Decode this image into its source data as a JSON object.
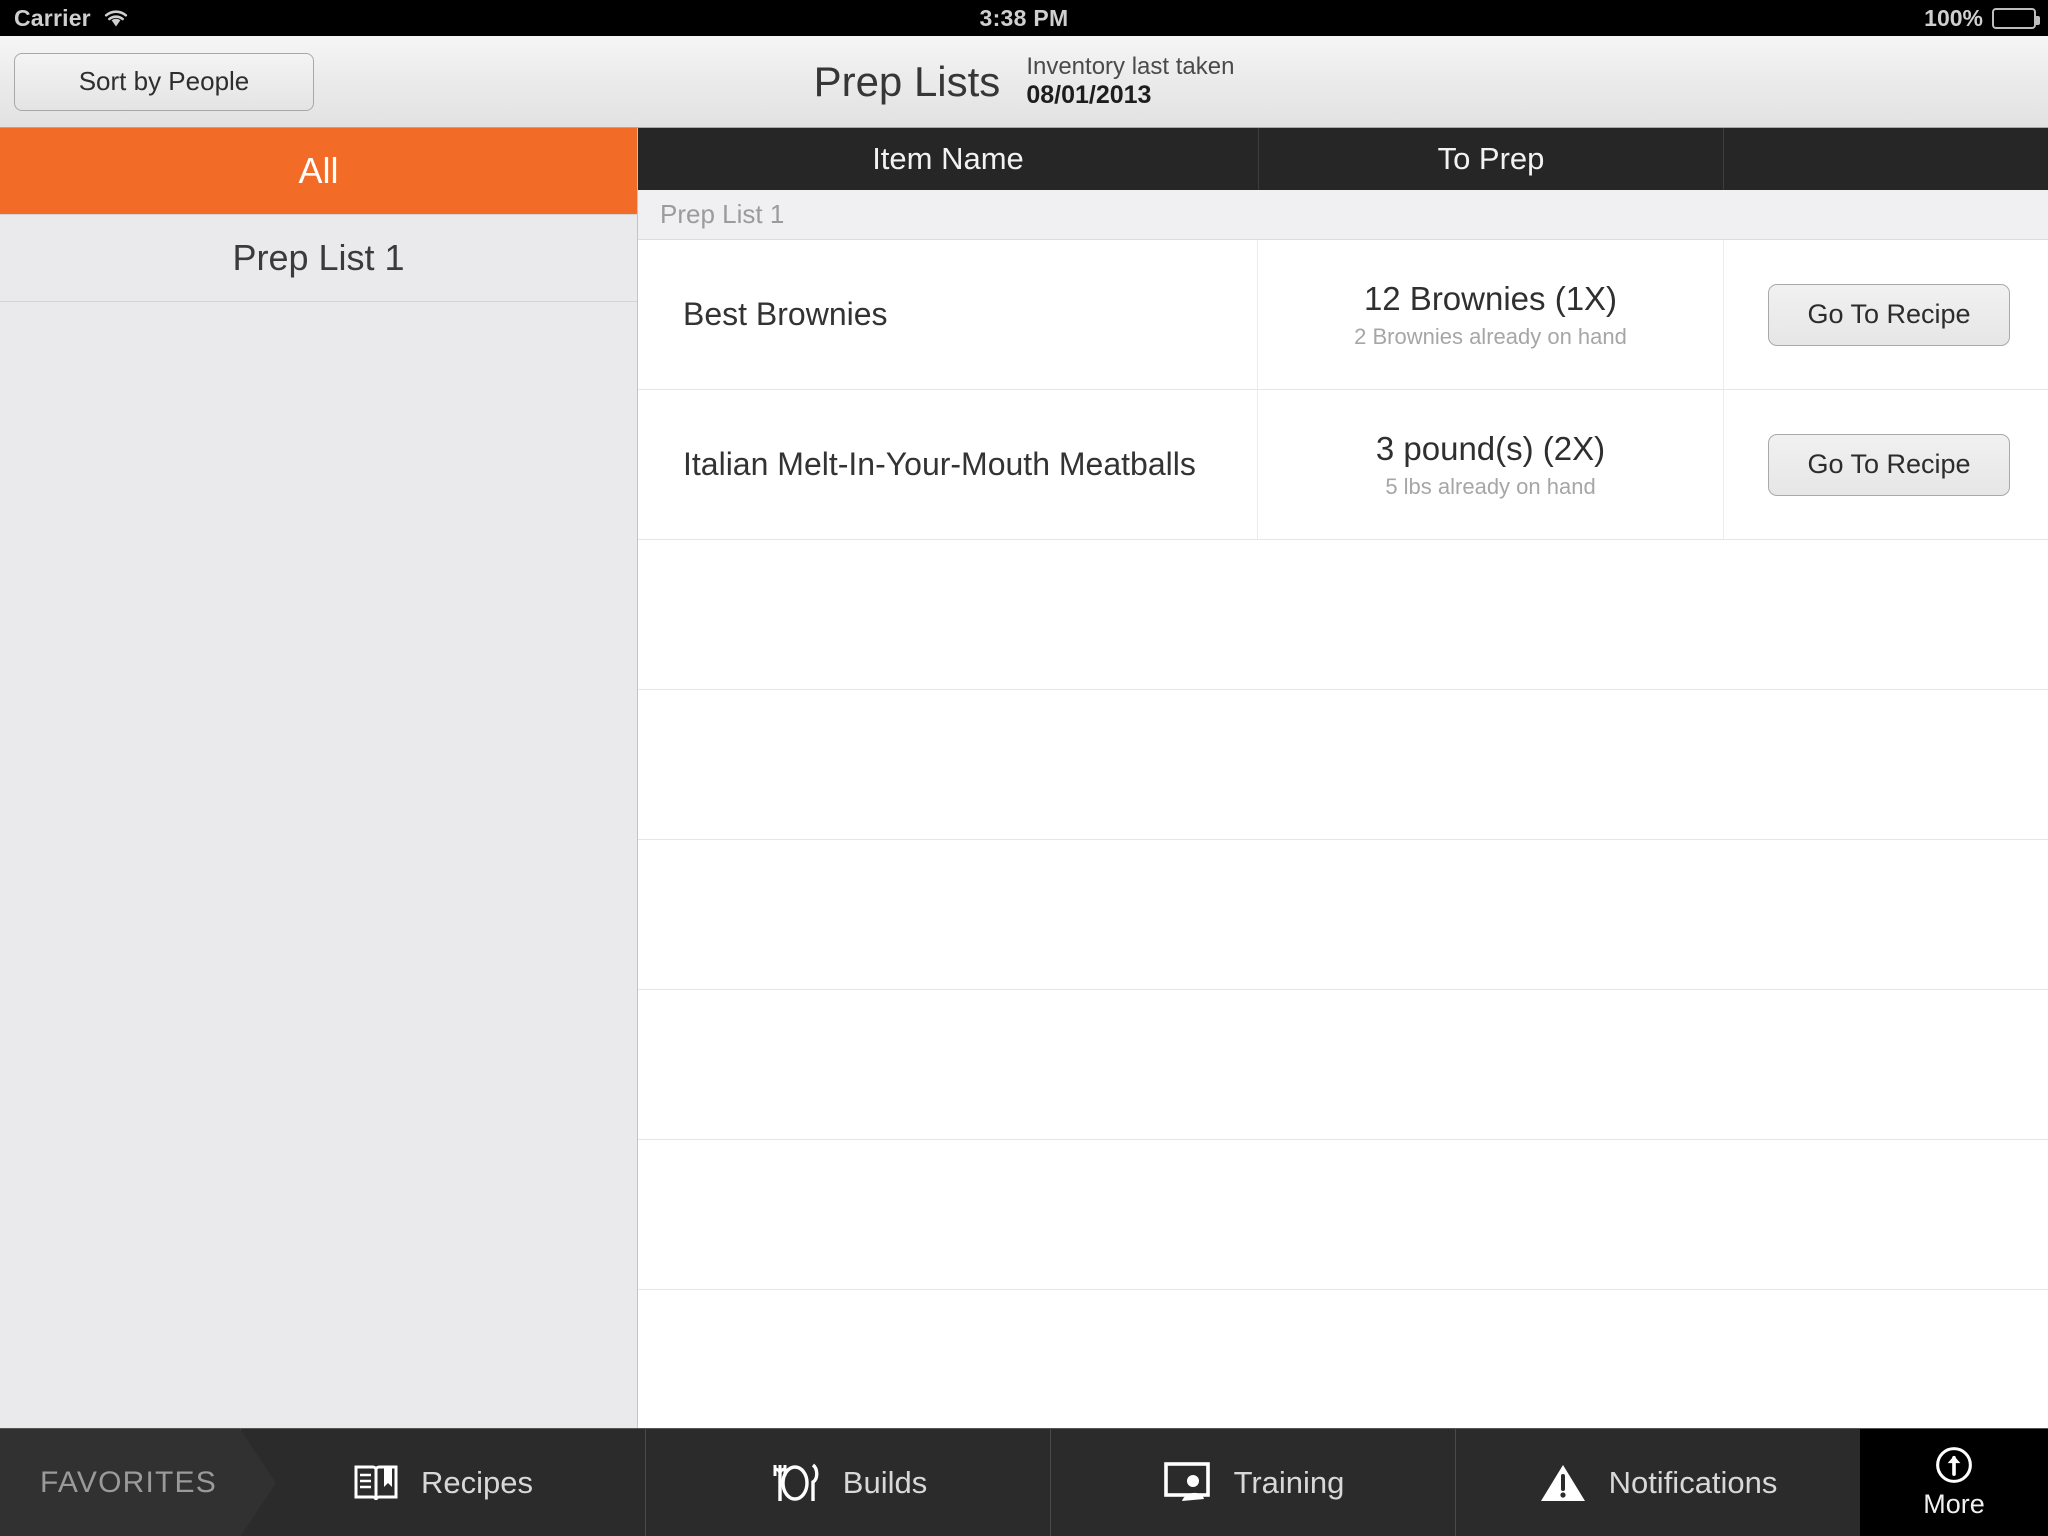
{
  "statusbar": {
    "carrier": "Carrier",
    "time": "3:38 PM",
    "battery_text": "100%",
    "wifi_icon": "wifi-icon",
    "battery_icon": "battery-icon"
  },
  "navbar": {
    "sort_button": "Sort by People",
    "title": "Prep Lists",
    "inventory_label": "Inventory last taken",
    "inventory_date": "08/01/2013"
  },
  "sidebar": {
    "items": [
      {
        "label": "All",
        "selected": true
      },
      {
        "label": "Prep List 1",
        "selected": false
      }
    ]
  },
  "table": {
    "columns": [
      "Item Name",
      "To Prep",
      ""
    ],
    "section_title": "Prep List 1",
    "rows": [
      {
        "item_name": "Best Brownies",
        "to_prep": "12 Brownies (1X)",
        "on_hand": "2 Brownies already on hand",
        "action": "Go To Recipe"
      },
      {
        "item_name": "Italian Melt-In-Your-Mouth Meatballs",
        "to_prep": "3 pound(s) (2X)",
        "on_hand": "5 lbs already on hand",
        "action": "Go To Recipe"
      }
    ],
    "empty_row_count": 6
  },
  "tabbar": {
    "favorites_label": "FAVORITES",
    "tabs": [
      {
        "label": "Recipes",
        "icon": "book-icon"
      },
      {
        "label": "Builds",
        "icon": "cutlery-icon"
      },
      {
        "label": "Training",
        "icon": "presentation-icon"
      },
      {
        "label": "Notifications",
        "icon": "warning-triangle-icon"
      }
    ],
    "more": {
      "label": "More",
      "icon": "circle-up-arrow-icon"
    }
  },
  "colors": {
    "accent_orange": "#f26c27",
    "header_dark": "#262626",
    "tabbar_dark": "#2b2b2b"
  }
}
